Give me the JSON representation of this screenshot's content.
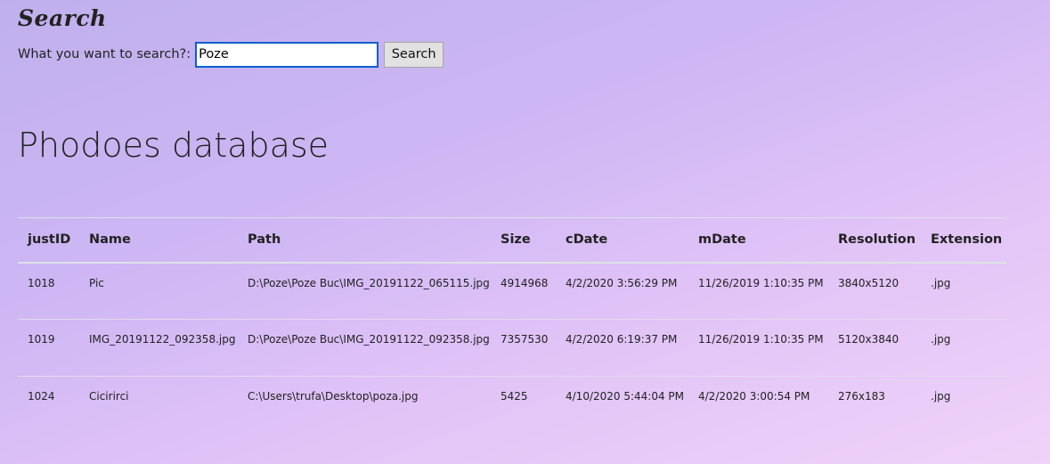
{
  "search": {
    "title": "Search",
    "label": "What you want to search?:",
    "value": "Poze",
    "button_label": "Search"
  },
  "page": {
    "title": "Phodoes database"
  },
  "table": {
    "headers": [
      "justID",
      "Name",
      "Path",
      "Size",
      "cDate",
      "mDate",
      "Resolution",
      "Extension"
    ],
    "rows": [
      [
        "1018",
        "Pic",
        "D:\\Poze\\Poze Buc\\IMG_20191122_065115.jpg",
        "4914968",
        "4/2/2020 3:56:29 PM",
        "11/26/2019 1:10:35 PM",
        "3840x5120",
        ".jpg"
      ],
      [
        "1019",
        "IMG_20191122_092358.jpg",
        "D:\\Poze\\Poze Buc\\IMG_20191122_092358.jpg",
        "7357530",
        "4/2/2020 6:19:37 PM",
        "11/26/2019 1:10:35 PM",
        "5120x3840",
        ".jpg"
      ],
      [
        "1024",
        "Cicirirci",
        "C:\\Users\\trufa\\Desktop\\poza.jpg",
        "5425",
        "4/10/2020 5:44:04 PM",
        "4/2/2020 3:00:54 PM",
        "276x183",
        ".jpg"
      ]
    ]
  }
}
